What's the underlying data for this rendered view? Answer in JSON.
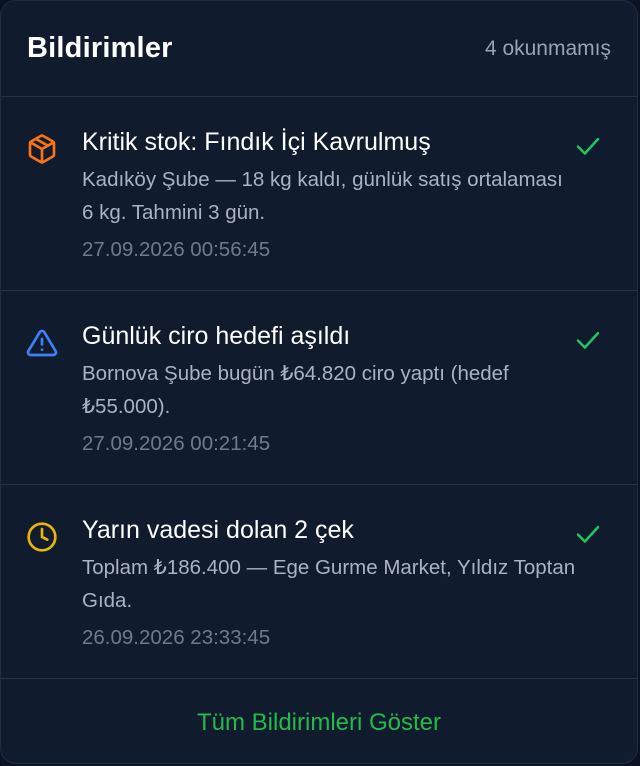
{
  "header": {
    "title": "Bildirimler",
    "unread_count": "4 okunmamış"
  },
  "notifications": [
    {
      "icon": "box-icon",
      "icon_color": "#f97316",
      "title": "Kritik stok: Fındık İçi Kavrulmuş",
      "body": "Kadıköy Şube — 18 kg kaldı, günlük satış ortalaması 6 kg. Tahmini 3 gün.",
      "time": "27.09.2026 00:56:45"
    },
    {
      "icon": "warning-triangle-icon",
      "icon_color": "#3b82f6",
      "title": "Günlük ciro hedefi aşıldı",
      "body": "Bornova Şube bugün ₺64.820 ciro yaptı (hedef ₺55.000).",
      "time": "27.09.2026 00:21:45"
    },
    {
      "icon": "clock-icon",
      "icon_color": "#eab308",
      "title": "Yarın vadesi dolan 2 çek",
      "body": "Toplam ₺186.400 — Ege Gurme Market, Yıldız Toptan Gıda.",
      "time": "26.09.2026 23:33:45"
    }
  ],
  "check_color": "#22c55e",
  "footer": {
    "link_label": "Tüm Bildirimleri Göster"
  }
}
